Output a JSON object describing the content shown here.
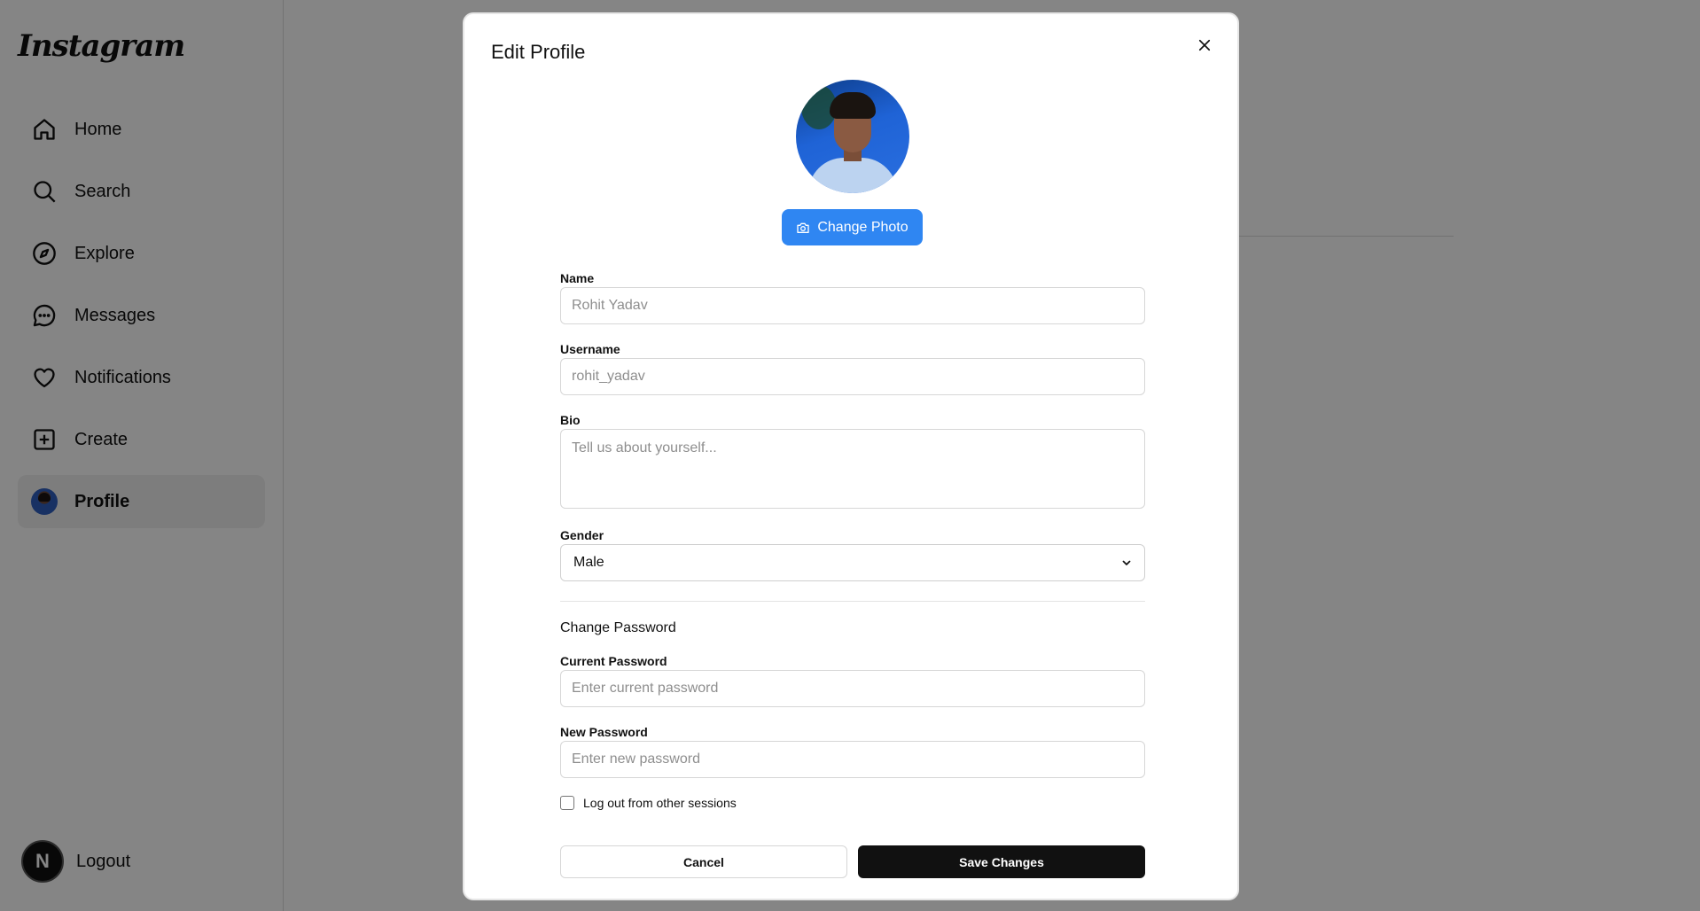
{
  "app": {
    "logo": "Instagram"
  },
  "sidebar": {
    "items": [
      {
        "label": "Home",
        "icon": "home-icon"
      },
      {
        "label": "Search",
        "icon": "search-icon"
      },
      {
        "label": "Explore",
        "icon": "compass-icon"
      },
      {
        "label": "Messages",
        "icon": "message-icon"
      },
      {
        "label": "Notifications",
        "icon": "heart-icon"
      },
      {
        "label": "Create",
        "icon": "plus-square-icon"
      },
      {
        "label": "Profile",
        "icon": "avatar",
        "active": true
      }
    ],
    "logout": {
      "label": "Logout",
      "badge": "N"
    }
  },
  "modal": {
    "title": "Edit Profile",
    "change_photo_label": "Change Photo",
    "name": {
      "label": "Name",
      "placeholder": "Rohit Yadav",
      "value": ""
    },
    "username": {
      "label": "Username",
      "placeholder": "rohit_yadav",
      "value": ""
    },
    "bio": {
      "label": "Bio",
      "placeholder": "Tell us about yourself...",
      "value": ""
    },
    "gender": {
      "label": "Gender",
      "value": "Male"
    },
    "password_section_title": "Change Password",
    "current_password": {
      "label": "Current Password",
      "placeholder": "Enter current password"
    },
    "new_password": {
      "label": "New Password",
      "placeholder": "Enter new password"
    },
    "logout_sessions": {
      "label": "Log out from other sessions",
      "checked": false
    },
    "cancel_label": "Cancel",
    "save_label": "Save Changes"
  },
  "colors": {
    "primary": "#2f86f2",
    "dark_button": "#111111",
    "overlay": "rgba(0,0,0,0.48)"
  }
}
